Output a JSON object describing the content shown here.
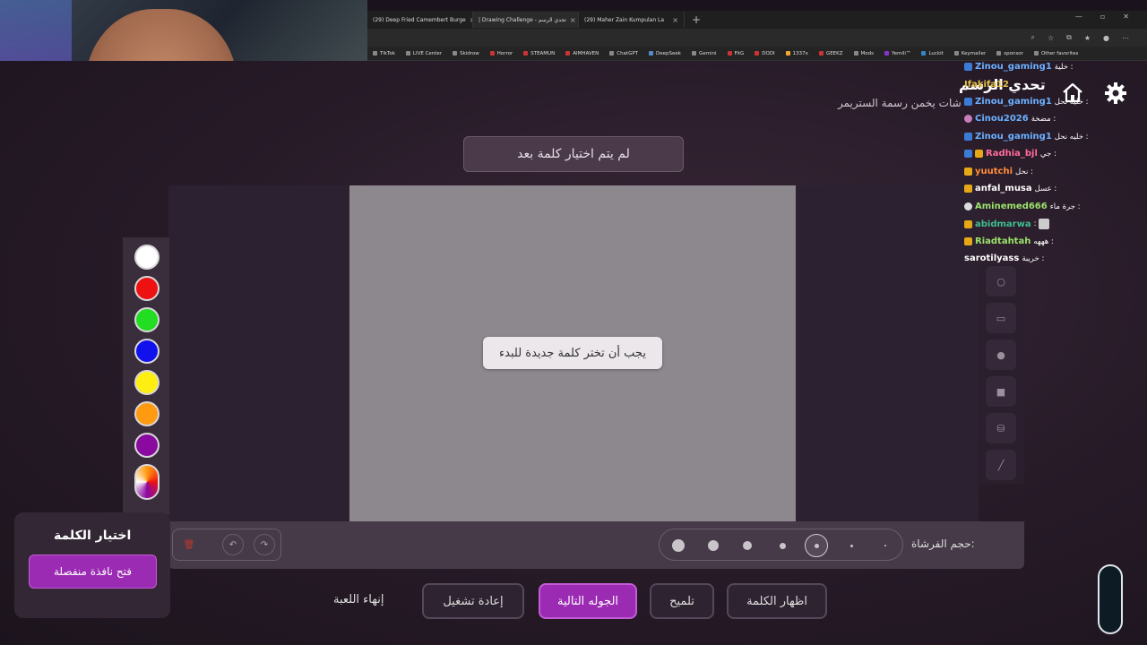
{
  "browser": {
    "tabs": [
      {
        "label": "(29) Deep Fried Camembert Burge"
      },
      {
        "label": "| Drawing Challenge - تحدي الرسم"
      },
      {
        "label": "(29) Maher Zain Kumpulan La"
      }
    ],
    "bookmarks": [
      "TikTok",
      "LIVE Center",
      "Skidrow",
      "Horror",
      "STEAMUN",
      "AIMHAVEN",
      "ChatGPT",
      "DeepSeek",
      "Gemini",
      "FitG",
      "DODI",
      "1337x",
      "GEEKZ",
      "Mods",
      "Yemili™",
      "Luckit",
      "Keymailer",
      "sponsor",
      "Other favorites"
    ]
  },
  "header": {
    "title": "تحدي الرسم",
    "subtitle": "شات يخمن رسمة الستريمر",
    "word_status": "لم يتم اختيار كلمة بعد"
  },
  "canvas": {
    "message": "يجب أن تختر كلمة جديدة للبدء"
  },
  "palette": {
    "colors": [
      "#ffffff",
      "#ee1111",
      "#22dd22",
      "#1111ee",
      "#ffee11",
      "#ff9a11",
      "#8a0aa0",
      "multicolor"
    ]
  },
  "tools": [
    "circle-outline",
    "square-outline",
    "circle-filled",
    "square-filled",
    "fill-bucket",
    "line"
  ],
  "brush": {
    "label": "حجم الفرشاة:",
    "selected_index": 4
  },
  "choose_panel": {
    "title": "اختيار الكلمة",
    "button": "فتح نافذة منفصلة"
  },
  "game_buttons": {
    "show_word": "اظهار الكلمة",
    "hint": "تلميح",
    "next_round": "الجوله التالية",
    "restart": "إعادة تشغيل",
    "end_game": "إنهاء اللعبة"
  },
  "chat": [
    {
      "user": "Zinou_gaming1",
      "msg": "خلية :",
      "color": "#6bb0ff"
    },
    {
      "user": "Ifakifa12",
      "msg": "",
      "color": "#e3c24a"
    },
    {
      "user": "Zinou_gaming1",
      "msg": "خلية نحل :",
      "color": "#6bb0ff"
    },
    {
      "user": "Cinou2026",
      "msg": "مضخة :",
      "color": "#6bb0ff"
    },
    {
      "user": "Zinou_gaming1",
      "msg": "خليه نحل :",
      "color": "#6bb0ff"
    },
    {
      "user": "Radhia_bjl",
      "msg": "جي :",
      "color": "#ff6b9a"
    },
    {
      "user": "yuutchi",
      "msg": "نحل :",
      "color": "#ff8c3b"
    },
    {
      "user": "anfal_musa",
      "msg": "عسل :",
      "color": "#ffffff"
    },
    {
      "user": "Aminemed666",
      "msg": "جرة ماء :",
      "color": "#9be36b"
    },
    {
      "user": "abidmarwa",
      "msg": ":",
      "color": "#3fbf8f"
    },
    {
      "user": "Riadtahtah",
      "msg": "هههه :",
      "color": "#9be36b"
    },
    {
      "user": "sarotilyass",
      "msg": "خريبة :",
      "color": "#ffffff"
    }
  ]
}
